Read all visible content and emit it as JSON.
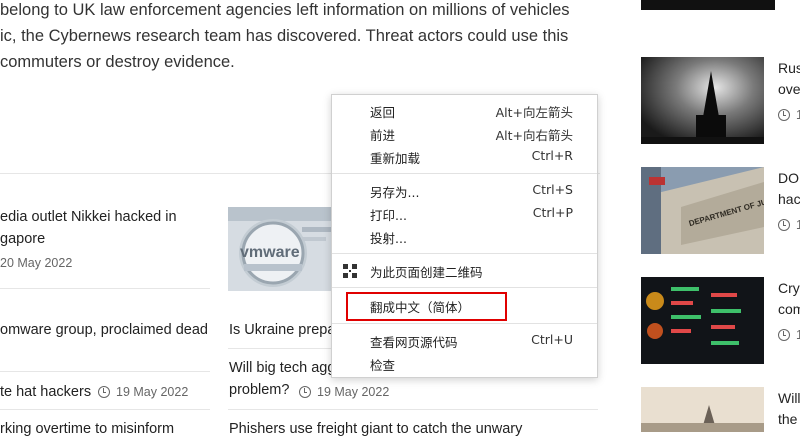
{
  "article": {
    "intro_lines": [
      "belong to UK law enforcement agencies left information on millions of vehicles",
      "ic, the Cybernews research team has discovered. Threat actors could use this",
      "commuters or destroy evidence."
    ]
  },
  "related": {
    "left": [
      {
        "title_lines": [
          "edia outlet Nikkei hacked in",
          "gapore"
        ],
        "date": "20 May 2022"
      },
      {
        "title_lines": [
          "omware group, proclaimed dead"
        ]
      },
      {
        "title_lines": [
          "te hat hackers"
        ],
        "date": "19 May 2022"
      },
      {
        "title_lines": [
          "rking overtime to misinform"
        ]
      }
    ],
    "middle": [
      {
        "title": "Is Ukraine prepar",
        "thumb_text": "vmware"
      },
      {
        "title_lines": [
          "Will big tech agg",
          "problem?"
        ],
        "date": "19 May 2022"
      },
      {
        "title": "Phishers use freight giant to catch the unwary"
      }
    ]
  },
  "sidebar": {
    "items": [
      {
        "title_lines": [
          "Rus",
          "ove"
        ],
        "date": "1"
      },
      {
        "title_lines": [
          "DO.",
          "hac"
        ],
        "date": "1"
      },
      {
        "title_lines": [
          "Cryp",
          "com"
        ],
        "date": "1"
      },
      {
        "title_lines": [
          "Will",
          "the"
        ]
      }
    ],
    "doj_sign": "DEPARTMENT OF JUSTICE"
  },
  "context_menu": {
    "items": [
      {
        "label": "返回",
        "shortcut": "Alt+向左箭头"
      },
      {
        "label": "前进",
        "shortcut": "Alt+向右箭头"
      },
      {
        "label": "重新加载",
        "shortcut": "Ctrl+R"
      },
      {
        "label": "另存为...",
        "shortcut": "Ctrl+S"
      },
      {
        "label": "打印...",
        "shortcut": "Ctrl+P"
      },
      {
        "label": "投射...",
        "shortcut": ""
      },
      {
        "label": "为此页面创建二维码",
        "shortcut": "",
        "icon": "qr-code-icon"
      },
      {
        "label": "翻成中文（简体）",
        "shortcut": "",
        "highlighted": true
      },
      {
        "label": "查看网页源代码",
        "shortcut": "Ctrl+U"
      },
      {
        "label": "检查",
        "shortcut": ""
      }
    ]
  },
  "colors": {
    "highlight_border": "#e00000",
    "text": "#222222",
    "meta": "#666666"
  }
}
